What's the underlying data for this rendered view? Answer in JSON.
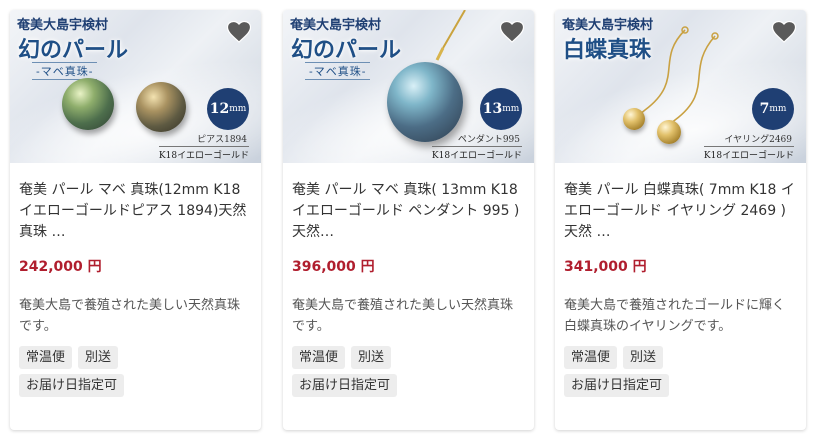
{
  "colors": {
    "price": "#b01e2e",
    "banner_text": "#1f4f86",
    "badge_bg": "#1f3f73",
    "tag_bg": "#ededed"
  },
  "products": [
    {
      "image": {
        "village": "奄美大島宇検村",
        "headline": "幻のパール",
        "subline": "-マベ真珠-",
        "size": "12",
        "size_unit": "mm",
        "model": "ピアス1894",
        "metal": "K18イエローゴールド"
      },
      "favorite_icon": "heart-icon",
      "title": "奄美 パール マベ 真珠(12mm K18 イエローゴールドピアス 1894)天然 真珠 …",
      "price": "242,000 円",
      "description": "奄美大島で養殖された美しい天然真珠です。",
      "tags": [
        "常温便",
        "別送",
        "お届け日指定可"
      ]
    },
    {
      "image": {
        "village": "奄美大島宇検村",
        "headline": "幻のパール",
        "subline": "-マベ真珠-",
        "size": "13",
        "size_unit": "mm",
        "model": "ペンダント995",
        "metal": "K18イエローゴールド"
      },
      "favorite_icon": "heart-icon",
      "title": "奄美 パール マベ 真珠( 13mm K18 イエローゴールド ペンダント 995 )天然…",
      "price": "396,000 円",
      "description": "奄美大島で養殖された美しい天然真珠です。",
      "tags": [
        "常温便",
        "別送",
        "お届け日指定可"
      ]
    },
    {
      "image": {
        "village": "奄美大島宇検村",
        "headline": "白蝶真珠",
        "subline": "",
        "size": "7",
        "size_unit": "mm",
        "model": "イヤリング2469",
        "metal": "K18イエローゴールド"
      },
      "favorite_icon": "heart-icon",
      "title": "奄美 パール 白蝶真珠( 7mm K18 イエローゴールド イヤリング 2469 )天然 …",
      "price": "341,000 円",
      "description": "奄美大島で養殖されたゴールドに輝く白蝶真珠のイヤリングです。",
      "tags": [
        "常温便",
        "別送",
        "お届け日指定可"
      ]
    }
  ]
}
